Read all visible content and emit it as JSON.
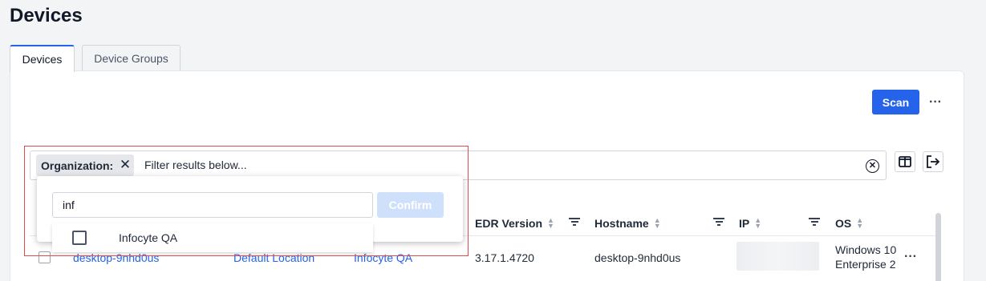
{
  "page": {
    "title": "Devices"
  },
  "tabs": [
    {
      "label": "Devices",
      "active": true
    },
    {
      "label": "Device Groups",
      "active": false
    }
  ],
  "toolbar": {
    "scan_label": "Scan",
    "more_icon": "more-horizontal-icon"
  },
  "filter": {
    "chip_label": "Organization:",
    "placeholder": "Filter results below...",
    "clear_icon": "clear-circle-icon"
  },
  "dropdown": {
    "search_value": "inf",
    "confirm_label": "Confirm",
    "options": [
      {
        "label": "Infocyte QA",
        "checked": false
      }
    ]
  },
  "table": {
    "columns": [
      "EDR Version",
      "Hostname",
      "IP",
      "OS"
    ],
    "rows": [
      {
        "name": "desktop-9nhd0us",
        "location": "Default Location",
        "organization": "Infocyte QA",
        "edr_version": "3.17.1.4720",
        "hostname": "desktop-9nhd0us",
        "os_line1": "Windows 10",
        "os_line2": "Enterprise 2"
      }
    ]
  },
  "colors": {
    "accent": "#2563eb",
    "highlight": "#e04b4b",
    "confirm_disabled": "#cfe0fb"
  }
}
